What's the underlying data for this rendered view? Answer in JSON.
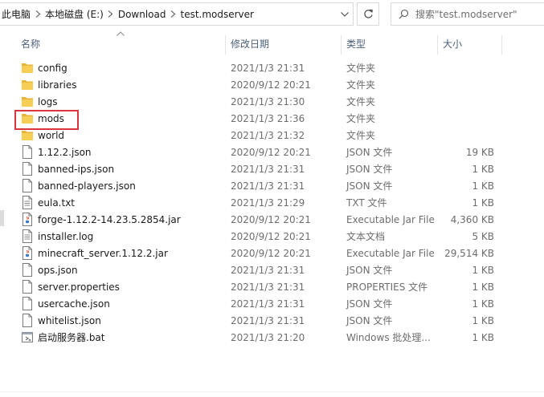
{
  "address": {
    "crumbs": [
      "此电脑",
      "本地磁盘 (E:)",
      "Download",
      "test.modserver"
    ]
  },
  "search": {
    "placeholder": "搜索\"test.modserver\""
  },
  "columns": {
    "name": "名称",
    "date": "修改日期",
    "type": "类型",
    "size": "大小"
  },
  "files": [
    {
      "name": "config",
      "date": "2021/1/3 21:31",
      "type": "文件夹",
      "size": "",
      "icon": "folder-icon"
    },
    {
      "name": "libraries",
      "date": "2020/9/12 20:21",
      "type": "文件夹",
      "size": "",
      "icon": "folder-icon"
    },
    {
      "name": "logs",
      "date": "2021/1/3 21:30",
      "type": "文件夹",
      "size": "",
      "icon": "folder-icon"
    },
    {
      "name": "mods",
      "date": "2021/1/3 21:36",
      "type": "文件夹",
      "size": "",
      "icon": "folder-icon"
    },
    {
      "name": "world",
      "date": "2021/1/3 21:32",
      "type": "文件夹",
      "size": "",
      "icon": "folder-icon"
    },
    {
      "name": "1.12.2.json",
      "date": "2020/9/12 20:21",
      "type": "JSON 文件",
      "size": "19 KB",
      "icon": "file-icon"
    },
    {
      "name": "banned-ips.json",
      "date": "2021/1/3 21:31",
      "type": "JSON 文件",
      "size": "1 KB",
      "icon": "file-icon"
    },
    {
      "name": "banned-players.json",
      "date": "2021/1/3 21:31",
      "type": "JSON 文件",
      "size": "1 KB",
      "icon": "file-icon"
    },
    {
      "name": "eula.txt",
      "date": "2021/1/3 21:29",
      "type": "TXT 文件",
      "size": "1 KB",
      "icon": "text-file-icon"
    },
    {
      "name": "forge-1.12.2-14.23.5.2854.jar",
      "date": "2020/9/12 20:21",
      "type": "Executable Jar File",
      "size": "4,360 KB",
      "icon": "jar-file-icon"
    },
    {
      "name": "installer.log",
      "date": "2020/9/12 20:21",
      "type": "文本文档",
      "size": "5 KB",
      "icon": "text-file-icon"
    },
    {
      "name": "minecraft_server.1.12.2.jar",
      "date": "2020/9/12 20:21",
      "type": "Executable Jar File",
      "size": "29,514 KB",
      "icon": "jar-file-icon"
    },
    {
      "name": "ops.json",
      "date": "2021/1/3 21:31",
      "type": "JSON 文件",
      "size": "1 KB",
      "icon": "file-icon"
    },
    {
      "name": "server.properties",
      "date": "2021/1/3 21:31",
      "type": "PROPERTIES 文件",
      "size": "1 KB",
      "icon": "file-icon"
    },
    {
      "name": "usercache.json",
      "date": "2021/1/3 21:31",
      "type": "JSON 文件",
      "size": "1 KB",
      "icon": "file-icon"
    },
    {
      "name": "whitelist.json",
      "date": "2021/1/3 21:31",
      "type": "JSON 文件",
      "size": "1 KB",
      "icon": "file-icon"
    },
    {
      "name": "启动服务器.bat",
      "date": "2021/1/3 21:20",
      "type": "Windows 批处理...",
      "size": "1 KB",
      "icon": "batch-file-icon"
    }
  ],
  "highlight": {
    "target": "mods",
    "color": "#d9363e"
  },
  "colors": {
    "header_text": "#4c607a",
    "folder": "#f3c94d",
    "muted_text": "#6d6d6d"
  }
}
